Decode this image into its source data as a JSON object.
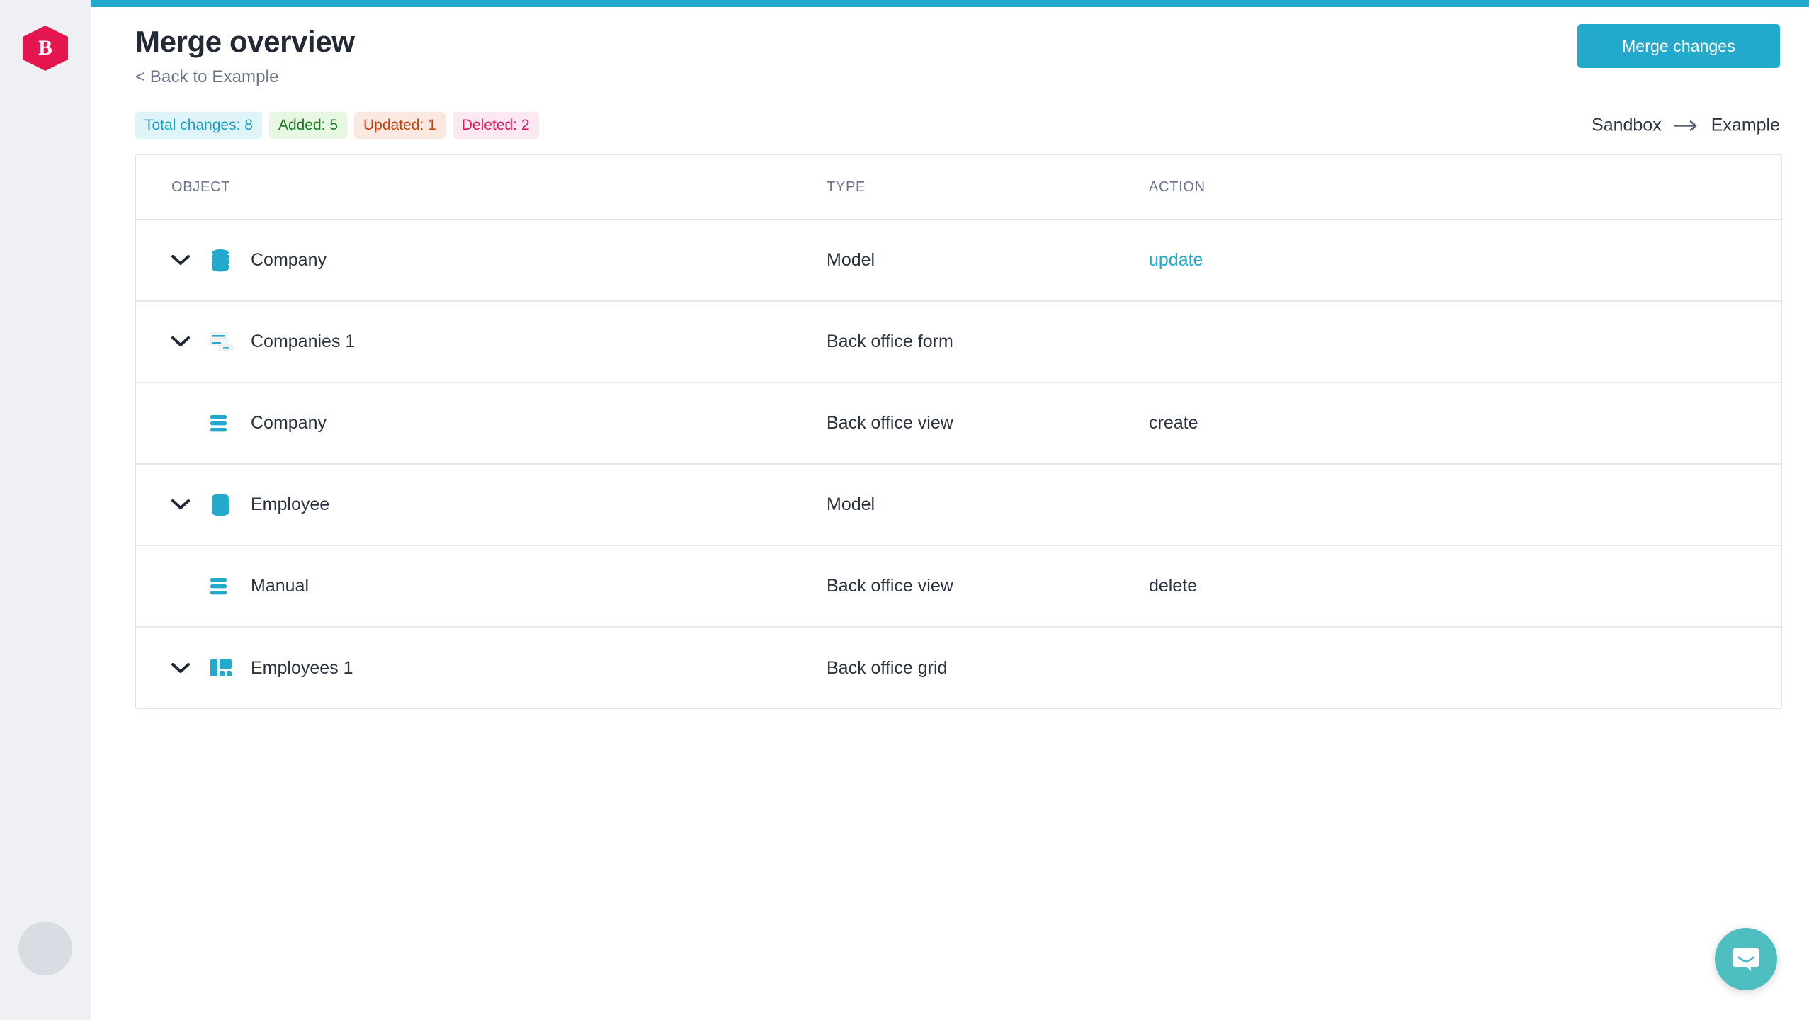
{
  "brand": {
    "logo_letter": "B",
    "logo_icon": "hexagon-b-logo",
    "logo_color": "#e4154f",
    "avatar_icon": "user-avatar-placeholder"
  },
  "theme": {
    "accent": "#23a9cb",
    "sidebar_bg": "#eff0f3",
    "text": "#2c3340",
    "muted": "#6b7489"
  },
  "header": {
    "title": "Merge overview",
    "back_link": "< Back to Example",
    "merge_button": "Merge changes"
  },
  "summary": {
    "badges": [
      {
        "label": "Total changes: 8",
        "kind": "total"
      },
      {
        "label": "Added: 5",
        "kind": "added"
      },
      {
        "label": "Updated: 1",
        "kind": "updated"
      },
      {
        "label": "Deleted: 2",
        "kind": "deleted"
      }
    ],
    "env_from": "Sandbox",
    "env_to": "Example",
    "env_arrow_icon": "arrow-right-icon"
  },
  "table": {
    "columns": [
      {
        "key": "object",
        "label": "OBJECT"
      },
      {
        "key": "type",
        "label": "TYPE"
      },
      {
        "key": "action",
        "label": "ACTION"
      }
    ],
    "rows": [
      {
        "expandable": true,
        "chevron_icon": "chevron-down-icon",
        "icon": "database-model-icon",
        "object": "Company",
        "type": "Model",
        "action": "update",
        "action_is_link": true
      },
      {
        "expandable": true,
        "chevron_icon": "chevron-down-icon",
        "icon": "back-office-form-icon",
        "object": "Companies 1",
        "type": "Back office form",
        "action": "",
        "action_is_link": false
      },
      {
        "expandable": false,
        "chevron_icon": "",
        "icon": "back-office-view-icon",
        "object": "Company",
        "type": "Back office view",
        "action": "create",
        "action_is_link": false
      },
      {
        "expandable": true,
        "chevron_icon": "chevron-down-icon",
        "icon": "database-model-icon",
        "object": "Employee",
        "type": "Model",
        "action": "",
        "action_is_link": false
      },
      {
        "expandable": false,
        "chevron_icon": "",
        "icon": "back-office-view-icon",
        "object": "Manual",
        "type": "Back office view",
        "action": "delete",
        "action_is_link": false
      },
      {
        "expandable": true,
        "chevron_icon": "chevron-down-icon",
        "icon": "back-office-grid-icon",
        "object": "Employees 1",
        "type": "Back office grid",
        "action": "",
        "action_is_link": false
      }
    ]
  },
  "support": {
    "launcher_icon": "chat-bubble-smile-icon",
    "launcher_color": "#4ebec0"
  }
}
